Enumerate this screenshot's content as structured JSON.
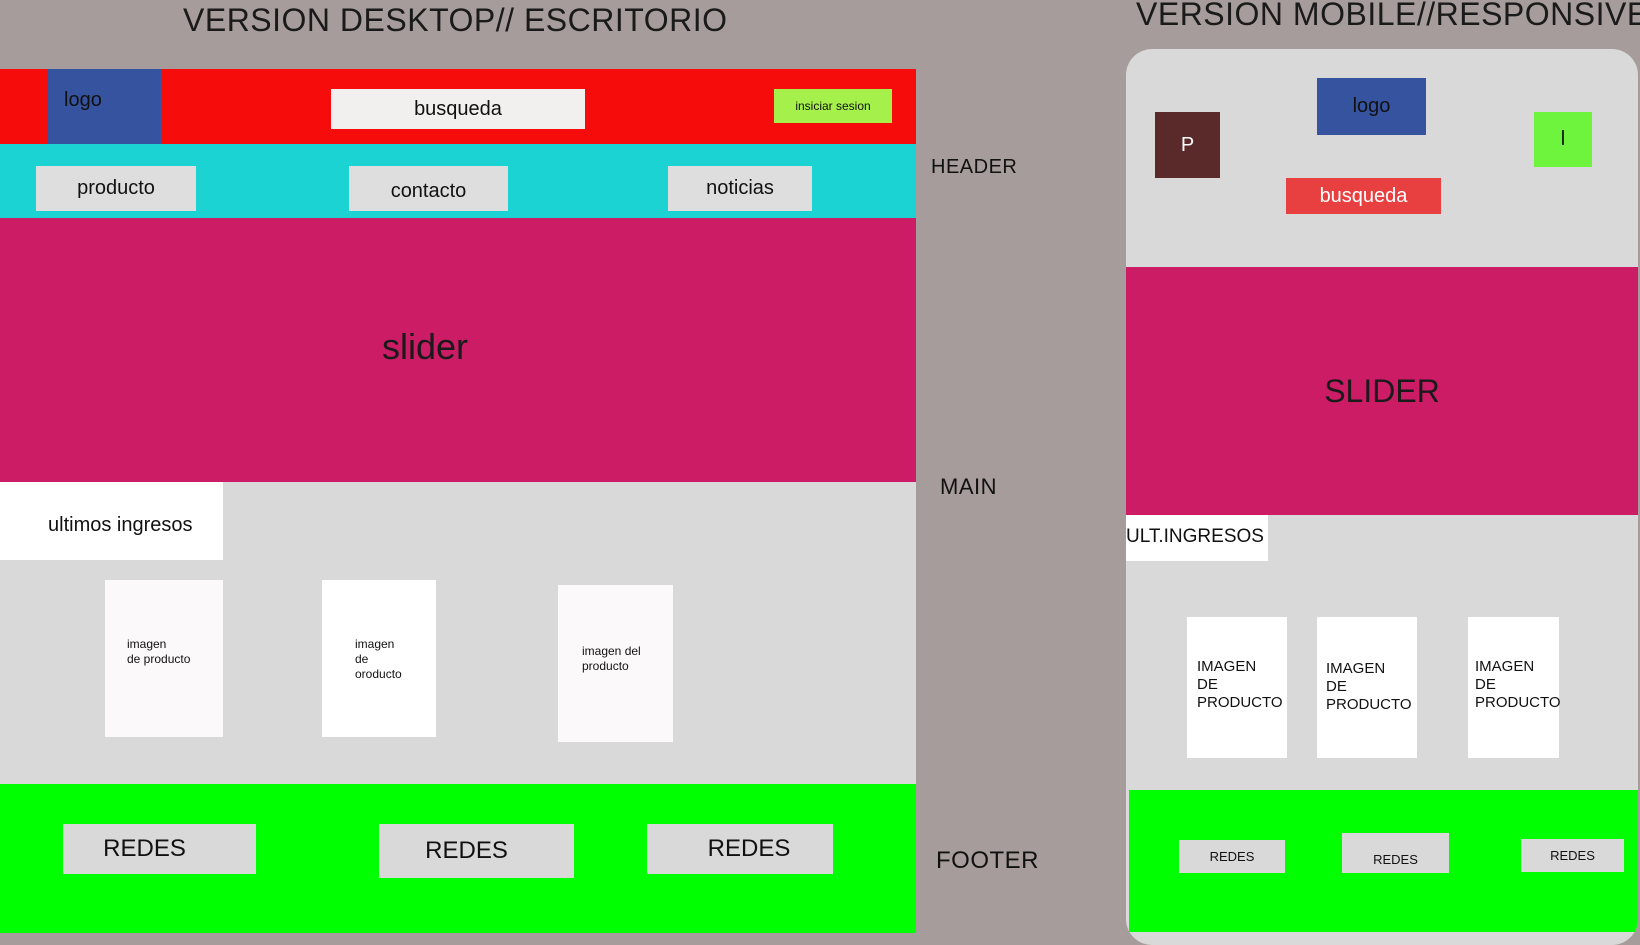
{
  "desktop": {
    "title": "VERSION DESKTOP// ESCRITORIO",
    "header": {
      "logo": "logo",
      "search": "busqueda",
      "login": "insiciar sesion"
    },
    "nav": [
      "producto",
      "contacto",
      "noticias"
    ],
    "slider": "slider",
    "latest": "ultimos ingresos",
    "products": [
      "imagen\nde producto",
      "imagen\nde\noroducto",
      "imagen del\nproducto"
    ],
    "footer": [
      "REDES",
      "REDES",
      "REDES"
    ]
  },
  "section_labels": {
    "header": "HEADER",
    "main": "MAIN",
    "footer": "FOOTER"
  },
  "mobile": {
    "title": "VERSION MOBILE//RESPONSIVE",
    "left_button": "P",
    "logo": "logo",
    "right_button": "l",
    "search": "busqueda",
    "slider": "SLIDER",
    "latest": "ULT.INGRESOS",
    "products": [
      "IMAGEN\nDE\nPRODUCTO",
      "IMAGEN\nDE\nPRODUCTO",
      "IMAGEN\nDE\nPRODUCTO"
    ],
    "footer": [
      "REDES",
      "REDES",
      "REDES"
    ]
  },
  "colors": {
    "canvas": "#a69c9b",
    "header_red": "#f70c0c",
    "logo_blue": "#3653a0",
    "nav_cyan": "#1bd3d3",
    "slider_magenta": "#cc1c66",
    "main_gray": "#d9d9d9",
    "footer_green": "#00ff00",
    "login_lime": "#a5f04a",
    "mobile_search_red": "#e84040",
    "mobile_p_brown": "#5a2a2a",
    "mobile_l_green": "#6ef43c"
  }
}
